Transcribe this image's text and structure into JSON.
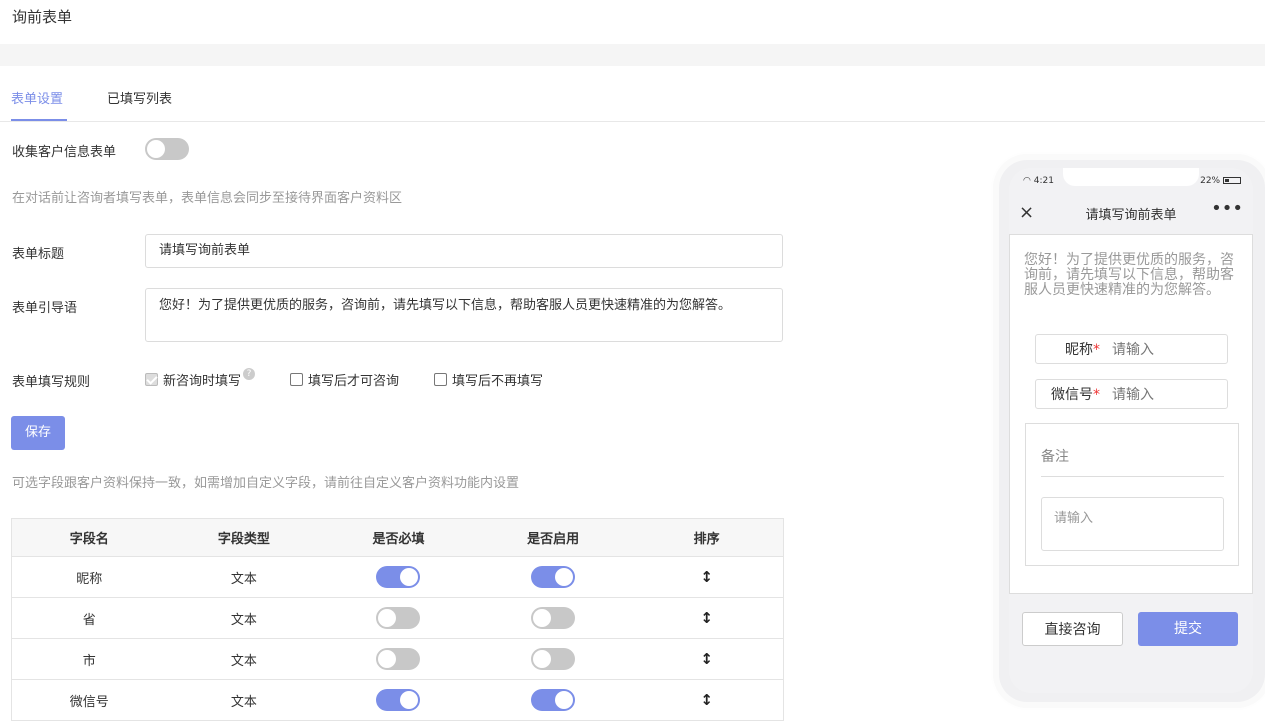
{
  "page": {
    "title": "询前表单"
  },
  "tabs": [
    {
      "label": "表单设置",
      "active": true
    },
    {
      "label": "已填写列表",
      "active": false
    }
  ],
  "collect": {
    "label": "收集客户信息表单",
    "enabled": false
  },
  "collect_hint": "在对话前让咨询者填写表单，表单信息会同步至接待界面客户资料区",
  "form_title": {
    "label": "表单标题",
    "value": "请填写询前表单"
  },
  "form_intro": {
    "label": "表单引导语",
    "value": "您好！为了提供更优质的服务，咨询前，请先填写以下信息，帮助客服人员更快速精准的为您解答。"
  },
  "rules": {
    "label": "表单填写规则",
    "options": [
      {
        "label": "新咨询时填写",
        "checked": true,
        "disabled": true,
        "help": "?"
      },
      {
        "label": "填写后才可咨询",
        "checked": false
      },
      {
        "label": "填写后不再填写",
        "checked": false
      }
    ]
  },
  "save_button": "保存",
  "fields_hint": "可选字段跟客户资料保持一致，如需增加自定义字段，请前往自定义客户资料功能内设置",
  "table": {
    "headers": [
      "字段名",
      "字段类型",
      "是否必填",
      "是否启用",
      "排序"
    ],
    "rows": [
      {
        "name": "昵称",
        "type": "文本",
        "required": true,
        "enabled": true
      },
      {
        "name": "省",
        "type": "文本",
        "required": false,
        "enabled": false
      },
      {
        "name": "市",
        "type": "文本",
        "required": false,
        "enabled": false
      },
      {
        "name": "微信号",
        "type": "文本",
        "required": true,
        "enabled": true
      }
    ],
    "sort_icon": "↕"
  },
  "phone": {
    "time": "4:21",
    "battery": "22%",
    "nav_title": "请填写询前表单",
    "close_icon": "×",
    "more_icon": "•••",
    "intro": "您好！为了提供更优质的服务，咨询前，请先填写以下信息，帮助客服人员更快速精准的为您解答。",
    "fields": [
      {
        "label": "昵称",
        "required_mark": "*",
        "placeholder": "请输入"
      },
      {
        "label": "微信号",
        "required_mark": "*",
        "placeholder": "请输入"
      }
    ],
    "note_label": "备注",
    "note_placeholder": "请输入",
    "buttons": {
      "direct": "直接咨询",
      "submit": "提交"
    }
  },
  "colors": {
    "accent": "#7b8ee8",
    "toggle_off": "#c8c8c8",
    "required": "#e33333"
  }
}
